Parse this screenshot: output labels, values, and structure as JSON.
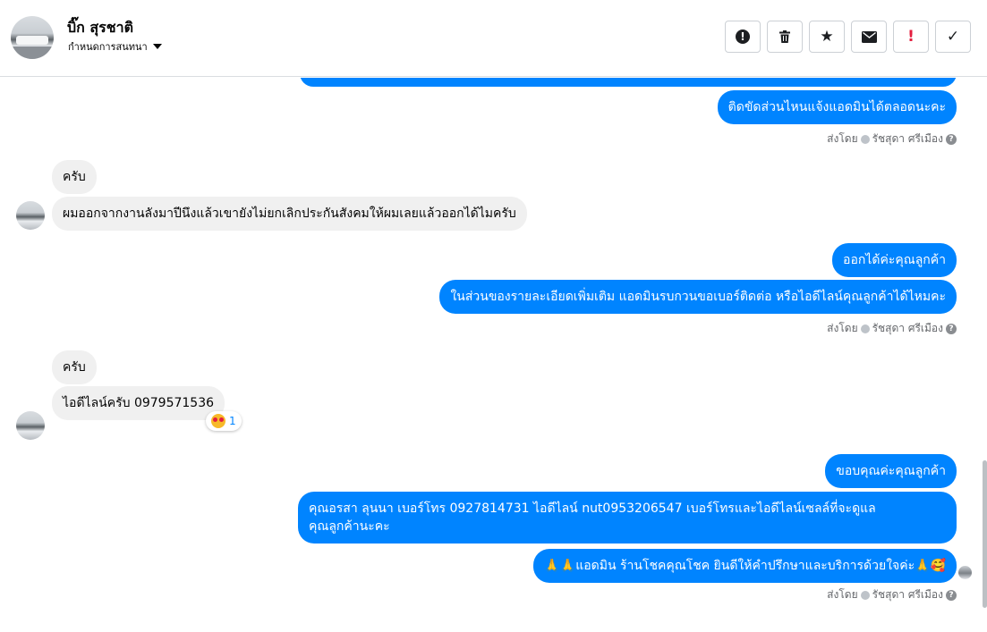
{
  "header": {
    "contact_name": "บิ๊ก สุรชาติ",
    "subtitle": "กำหนดการสนทนา",
    "toolbar": [
      {
        "name": "report-button",
        "icon": "alert-circle-icon",
        "glyph": "!"
      },
      {
        "name": "delete-button",
        "icon": "trash-icon",
        "glyph": "🗑"
      },
      {
        "name": "star-button",
        "icon": "star-icon",
        "glyph": "★"
      },
      {
        "name": "mark-unread-button",
        "icon": "envelope-icon",
        "glyph": "✉"
      },
      {
        "name": "spam-button",
        "icon": "exclamation-icon",
        "glyph": "!"
      },
      {
        "name": "done-button",
        "icon": "check-icon",
        "glyph": "✓"
      }
    ]
  },
  "messages": {
    "m1": "ติดขัดส่วนไหนแจ้งแอดมินได้ตลอดนะคะ",
    "sent1": {
      "label": "ส่งโดย",
      "sender": "รัชสุดา ศรีเมือง"
    },
    "m2": "ครับ",
    "m3": "ผมออกจากงานลังมาปีนึงแล้วเขายังไม่ยกเลิกประกันสังคมให้ผมเลยแล้วออกได้ไมครับ",
    "m4": "ออกได้ค่ะคุณลูกค้า",
    "m5": "ในส่วนของรายละเอียดเพิ่มเติม แอดมินรบกวนขอเบอร์ติดต่อ หรือไอดีไลน์คุณลูกค้าได้ไหมคะ",
    "sent2": {
      "label": "ส่งโดย",
      "sender": "รัชสุดา ศรีเมือง"
    },
    "m6": "ครับ",
    "m7": "ไอดีไลน์ครับ   0979571536",
    "reaction_count": "1",
    "m8": "ขอบคุณค่ะคุณลูกค้า",
    "m9_line1": "คุณอรสา ลุนนา       เบอร์โทร 0927814731  ไอดีไลน์ nut0953206547   เบอร์โทรและไอดีไลน์เซลล์ที่จะดูแล",
    "m9_line2": "คุณลูกค้านะคะ",
    "m10": "🙏🙏แอดมิน ร้านโชคคุณโชค ยินดีให้คำปรึกษาและบริการด้วยใจค่ะ🙏🥰",
    "sent3": {
      "label": "ส่งโดย",
      "sender": "รัชสุดา ศรีเมือง"
    }
  },
  "colors": {
    "outgoing": "#0084ff",
    "incoming": "#f0f0f0",
    "danger": "#e41e3f"
  }
}
